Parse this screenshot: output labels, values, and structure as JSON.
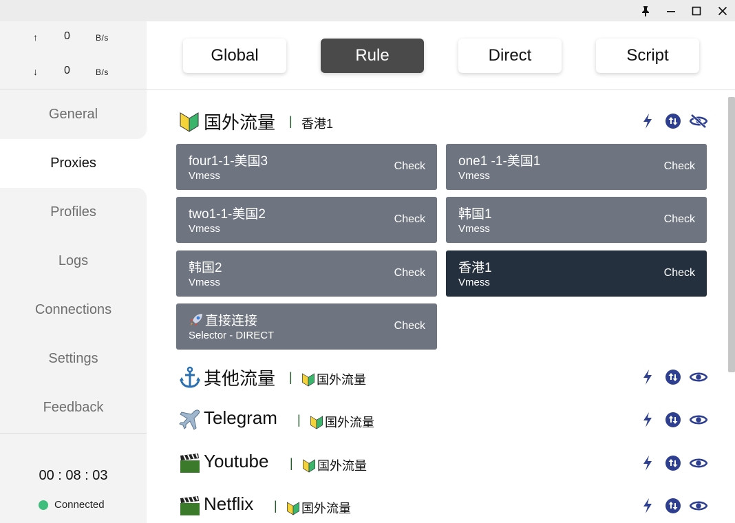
{
  "window": {
    "controls": [
      "pin-icon",
      "minimize-icon",
      "maximize-icon",
      "close-icon"
    ]
  },
  "traffic": {
    "up_arrow": "↑",
    "up_value": "0",
    "up_unit": "B/s",
    "down_arrow": "↓",
    "down_value": "0",
    "down_unit": "B/s"
  },
  "nav": {
    "items": [
      {
        "label": "General"
      },
      {
        "label": "Proxies"
      },
      {
        "label": "Profiles"
      },
      {
        "label": "Logs"
      },
      {
        "label": "Connections"
      },
      {
        "label": "Settings"
      },
      {
        "label": "Feedback"
      }
    ],
    "active": "Proxies"
  },
  "status": {
    "timer": "00 : 08 : 03",
    "connection": "Connected",
    "connection_color": "#3ebd7c"
  },
  "modes": {
    "items": [
      "Global",
      "Rule",
      "Direct",
      "Script"
    ],
    "active": "Rule"
  },
  "groups": [
    {
      "name": "国外流量",
      "emoji": "beginner-badge-icon",
      "selected": "香港1",
      "expanded": true,
      "proxies": [
        {
          "name": "four1-1-美国3",
          "type": "Vmess",
          "check": "Check"
        },
        {
          "name": "one1 -1-美国1",
          "type": "Vmess",
          "check": "Check"
        },
        {
          "name": "two1-1-美国2",
          "type": "Vmess",
          "check": "Check"
        },
        {
          "name": "韩国1",
          "type": "Vmess",
          "check": "Check"
        },
        {
          "name": "韩国2",
          "type": "Vmess",
          "check": "Check"
        },
        {
          "name": "香港1",
          "type": "Vmess",
          "check": "Check",
          "selected": true
        },
        {
          "name": "直接连接",
          "emoji": "rocket-icon",
          "type": "Selector - DIRECT",
          "check": "Check"
        }
      ]
    },
    {
      "name": "其他流量",
      "emoji": "anchor-icon",
      "selected": "国外流量",
      "expanded": false
    },
    {
      "name": "Telegram",
      "emoji": "airplane-icon",
      "selected": "国外流量",
      "expanded": false
    },
    {
      "name": "Youtube",
      "emoji": "clapper-board-icon",
      "selected": "国外流量",
      "expanded": false
    },
    {
      "name": "Netflix",
      "emoji": "clapper-board-icon",
      "selected": "国外流量",
      "expanded": false
    }
  ],
  "group_sep": "|",
  "colors": {
    "card": "#6e7580",
    "card_selected": "#25303f",
    "mode_active": "#4a4a4a",
    "icon_blue": "#2e3f8f"
  }
}
